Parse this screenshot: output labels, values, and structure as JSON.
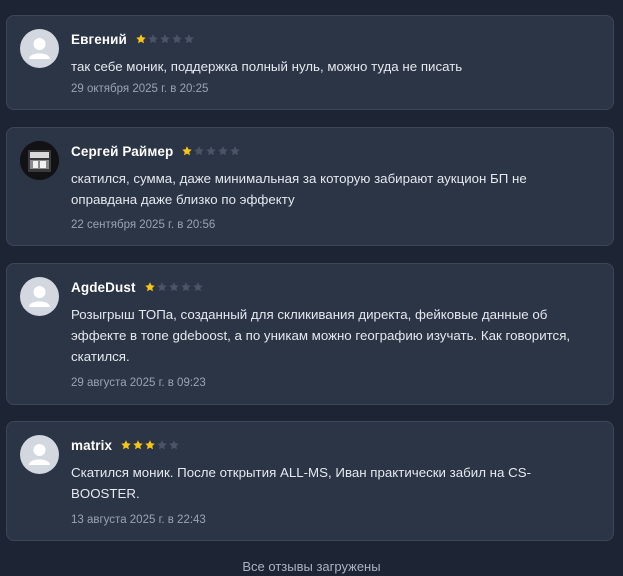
{
  "reviews": [
    {
      "author": "Евгений",
      "rating": 1,
      "avatar": "default-avatar",
      "text": "так себе моник, поддержка полный нуль, можно туда не писать",
      "date": "29 октября 2025 г. в 20:25"
    },
    {
      "author": "Сергей Раймер",
      "rating": 1,
      "avatar": "photo-avatar",
      "text": "скатился, сумма, даже минимальная за которую забирают аукцион БП не оправдана даже близко по эффекту",
      "date": "22 сентября 2025 г. в 20:56"
    },
    {
      "author": "AgdeDust",
      "rating": 1,
      "avatar": "default-avatar",
      "text": "Розыгрыш ТОПа, созданный для скликивания директа, фейковые данные об эффекте в топе gdeboost, а по уникам можно географию изучать. Как говорится, скатился.",
      "date": "29 августа 2025 г. в 09:23"
    },
    {
      "author": "matrix",
      "rating": 3,
      "avatar": "default-avatar",
      "text": "Скатился моник. После открытия ALL-MS, Иван практически забил на CS-BOOSTER.",
      "date": "13 августа 2025 г. в 22:43"
    }
  ],
  "rating_max": 5,
  "colors": {
    "star_filled": "#f5c518",
    "star_empty": "#4a5466",
    "card_bg": "#2c3546",
    "page_bg": "#1d2534"
  },
  "footer_text": "Все отзывы загружены"
}
